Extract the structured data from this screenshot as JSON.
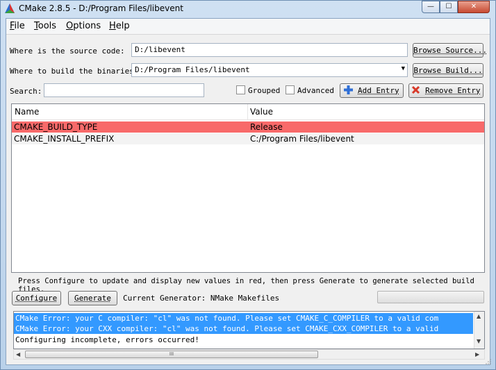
{
  "window": {
    "title": "CMake 2.8.5 - D:/Program Files/libevent",
    "min_glyph": "—",
    "max_glyph": "☐",
    "close_glyph": "✕"
  },
  "menu": [
    {
      "label": "File",
      "mnemonic": "F",
      "rest": "ile"
    },
    {
      "label": "Tools",
      "mnemonic": "T",
      "rest": "ools"
    },
    {
      "label": "Options",
      "mnemonic": "O",
      "rest": "ptions"
    },
    {
      "label": "Help",
      "mnemonic": "H",
      "rest": "elp"
    }
  ],
  "source": {
    "label": "Where is the source code:",
    "value": "D:/libevent",
    "browse_label": "Browse Source..."
  },
  "build": {
    "label": "Where to build the binaries:",
    "value": "D:/Program Files/libevent",
    "browse_label": "Browse Build..."
  },
  "search": {
    "label": "Search:",
    "value": ""
  },
  "options": {
    "grouped_label": "Grouped",
    "grouped_checked": false,
    "advanced_label": "Advanced",
    "advanced_checked": false,
    "add_entry_label": "Add Entry",
    "remove_entry_label": "Remove Entry"
  },
  "table": {
    "columns": [
      "Name",
      "Value"
    ],
    "rows": [
      {
        "name": "CMAKE_BUILD_TYPE",
        "value": "Release",
        "highlighted": true
      },
      {
        "name": "CMAKE_INSTALL_PREFIX",
        "value": "C:/Program Files/libevent",
        "highlighted": false
      }
    ]
  },
  "hint": "Press Configure to update and display new values in red, then press Generate to generate selected build files.",
  "actions": {
    "configure_label": "Configure",
    "generate_label": "Generate",
    "generator_text": "Current Generator: NMake Makefiles",
    "progress": 0
  },
  "output": [
    {
      "text": "CMake Error: your C compiler: \"cl\" was not found.   Please set CMAKE_C_COMPILER to a valid com",
      "error": true
    },
    {
      "text": "CMake Error: your CXX compiler: \"cl\" was not found.   Please set CMAKE_CXX_COMPILER to a valid",
      "error": true
    },
    {
      "text": "Configuring incomplete, errors occurred!",
      "error": false
    }
  ],
  "scroll": {
    "up": "▲",
    "down": "▼",
    "left": "◀",
    "right": "▶",
    "thumb_grip": "III"
  },
  "colors": {
    "highlight_row": "#f86a6a",
    "error_line": "#3399ff"
  }
}
